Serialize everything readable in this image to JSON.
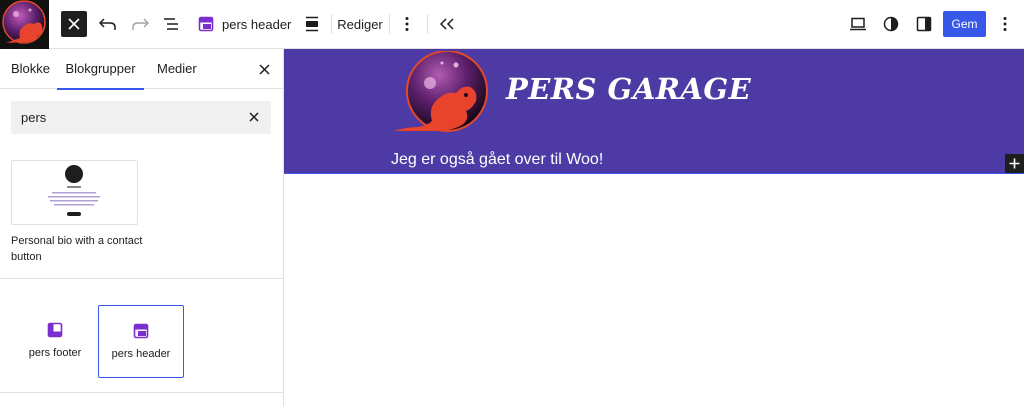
{
  "topbar": {
    "document_title": "pers header",
    "edit_label": "Rediger",
    "save_label": "Gem",
    "icons": [
      "close-icon",
      "undo-icon",
      "redo-icon",
      "list-view-icon",
      "template-part-icon",
      "align-icon",
      "more-vertical-icon",
      "collapse-icon",
      "desktop-preview-icon",
      "styles-icon",
      "settings-icon"
    ]
  },
  "inserter": {
    "tabs": [
      "Blokke",
      "Blokgrupper",
      "Medier"
    ],
    "active_tab": "Blokgrupper",
    "search_value": "pers",
    "patterns": [
      {
        "title": "Personal bio with a contact button"
      }
    ],
    "template_parts": [
      {
        "label": "pers footer"
      },
      {
        "label": "pers header"
      }
    ]
  },
  "canvas": {
    "site_title": "PERS GARAGE",
    "tagline": "Jeg er også gået over til Woo!",
    "header_color": "#4e3aa4"
  },
  "colors": {
    "accent": "#3858e9",
    "toolbar_dark": "#1e1e1e"
  }
}
